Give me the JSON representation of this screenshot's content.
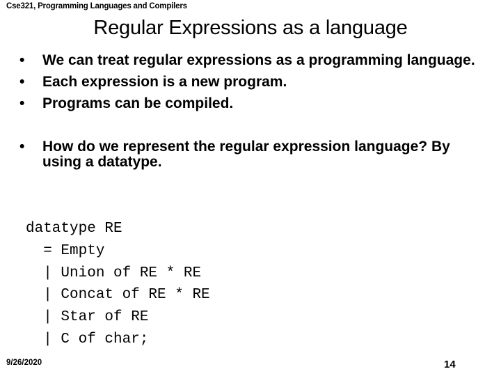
{
  "header": {
    "course": "Cse321, Programming Languages and Compilers"
  },
  "slide": {
    "title": "Regular Expressions as a language",
    "bullets": [
      "We can treat regular expressions as a programming language.",
      "Each expression is a new program.",
      "Programs can be compiled.",
      "How do we represent the regular expression language? By using a datatype."
    ],
    "bullet_glyph": "•",
    "code_lines": [
      "datatype RE",
      "  = Empty",
      "  | Union of RE * RE",
      "  | Concat of RE * RE",
      "  | Star of RE",
      "  | C of char;"
    ]
  },
  "footer": {
    "date": "9/26/2020",
    "page_number": "14"
  }
}
